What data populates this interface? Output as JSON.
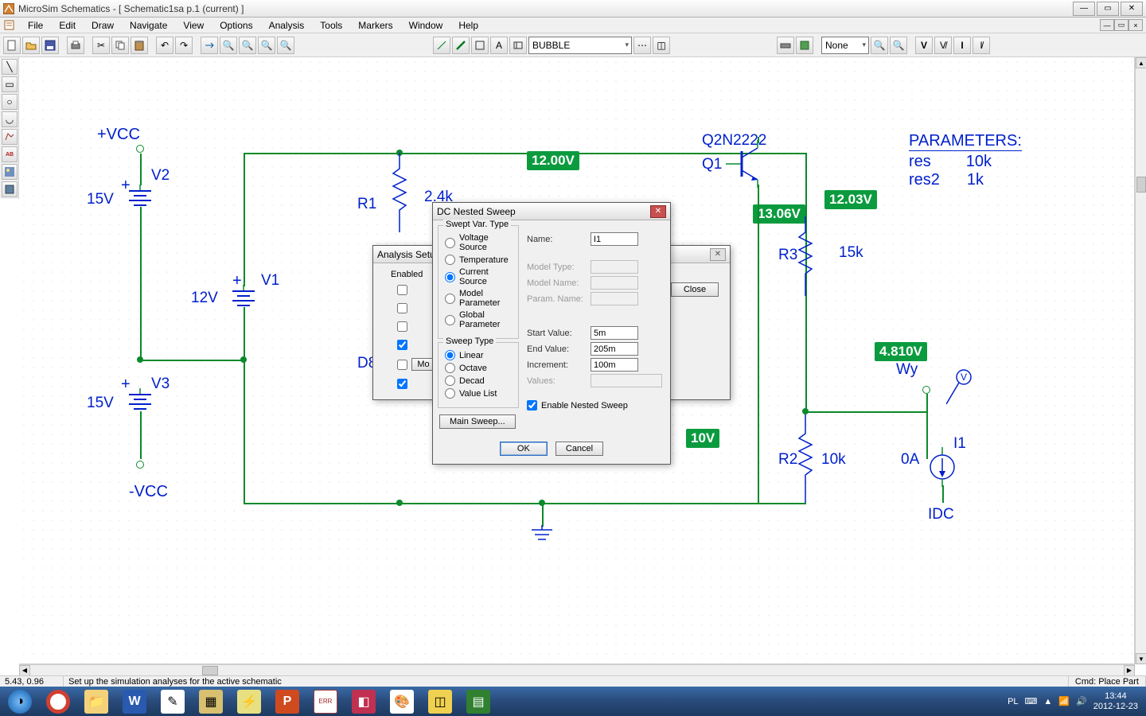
{
  "title": "MicroSim Schematics - [ Schematic1sa  p.1  (current)  ]",
  "menu": [
    "File",
    "Edit",
    "Draw",
    "Navigate",
    "View",
    "Options",
    "Analysis",
    "Tools",
    "Markers",
    "Window",
    "Help"
  ],
  "toolbar": {
    "combo1": "BUBBLE",
    "combo2": "None"
  },
  "schematic": {
    "labels": {
      "pvcc": "+VCC",
      "nvcc": "-VCC",
      "v1": "V1",
      "v1val": "12V",
      "v2": "V2",
      "v2val": "15V",
      "v3": "V3",
      "v3val": "15V",
      "r1": "R1",
      "r1val": "2.4k",
      "r2": "R2",
      "r2val": "10k",
      "r3": "R3",
      "r3val": "15k",
      "d8": "D8",
      "q1": "Q1",
      "q1model": "Q2N2222",
      "i1": "I1",
      "i1val": "0A",
      "idc": "IDC",
      "wy": "Wy",
      "vprobe": "V"
    },
    "badges": {
      "b1": "12.00V",
      "b2": "13.06V",
      "b3": "12.03V",
      "b4": "4.810V",
      "b5": "10V"
    },
    "params": {
      "header": "PARAMETERS:",
      "rows": [
        {
          "name": "res",
          "val": "10k"
        },
        {
          "name": "res2",
          "val": "1k"
        }
      ]
    }
  },
  "dialog_setup": {
    "title": "Analysis Setup",
    "enabled_label": "Enabled",
    "rows": [
      {
        "checked": false,
        "label": ""
      },
      {
        "checked": false,
        "label": ""
      },
      {
        "checked": false,
        "label": ""
      },
      {
        "checked": true,
        "label": ""
      },
      {
        "checked": false,
        "label": "Mo"
      },
      {
        "checked": true,
        "label": ""
      }
    ],
    "close": "Close"
  },
  "dialog_sweep": {
    "title": "DC Nested Sweep",
    "swept_var_legend": "Swept Var. Type",
    "swept_options": [
      "Voltage Source",
      "Temperature",
      "Current Source",
      "Model Parameter",
      "Global Parameter"
    ],
    "swept_selected": 2,
    "sweep_type_legend": "Sweep Type",
    "sweep_options": [
      "Linear",
      "Octave",
      "Decad",
      "Value List"
    ],
    "sweep_selected": 0,
    "name_label": "Name:",
    "name_val": "I1",
    "modeltype_label": "Model Type:",
    "modelname_label": "Model Name:",
    "paramname_label": "Param. Name:",
    "start_label": "Start Value:",
    "start_val": "5m",
    "end_label": "End Value:",
    "end_val": "205m",
    "inc_label": "Increment:",
    "inc_val": "100m",
    "values_label": "Values:",
    "main_sweep": "Main Sweep...",
    "enable_nested": "Enable Nested Sweep",
    "ok": "OK",
    "cancel": "Cancel"
  },
  "status": {
    "coords": "5.43,  0.96",
    "msg": "Set up the simulation analyses for the active schematic",
    "cmd": "Cmd: Place Part"
  },
  "tray": {
    "lang": "PL",
    "time": "13:44",
    "date": "2012-12-23"
  }
}
